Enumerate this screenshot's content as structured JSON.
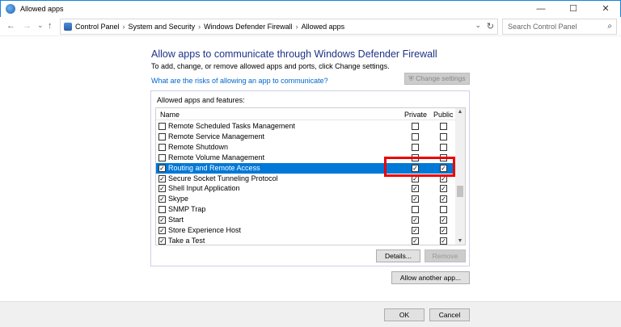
{
  "window": {
    "title": "Allowed apps",
    "minimize": "—",
    "maximize": "☐",
    "close": "✕"
  },
  "address": {
    "back": "←",
    "forward": "→",
    "recent": "⌄",
    "up": "↑",
    "crumbs": [
      "Control Panel",
      "System and Security",
      "Windows Defender Firewall",
      "Allowed apps"
    ],
    "separator": "›",
    "dropdown": "⌄",
    "refresh": "↻",
    "search_placeholder": "Search Control Panel"
  },
  "main": {
    "heading": "Allow apps to communicate through Windows Defender Firewall",
    "subtext": "To add, change, or remove allowed apps and ports, click Change settings.",
    "risk_link": "What are the risks of allowing an app to communicate?",
    "change_settings": "Change settings"
  },
  "list": {
    "label": "Allowed apps and features:",
    "columns": {
      "name": "Name",
      "private": "Private",
      "public": "Public"
    },
    "rows": [
      {
        "name": "Remote Scheduled Tasks Management",
        "enabled": false,
        "private": false,
        "public": false
      },
      {
        "name": "Remote Service Management",
        "enabled": false,
        "private": false,
        "public": false
      },
      {
        "name": "Remote Shutdown",
        "enabled": false,
        "private": false,
        "public": false
      },
      {
        "name": "Remote Volume Management",
        "enabled": false,
        "private": false,
        "public": false
      },
      {
        "name": "Routing and Remote Access",
        "enabled": true,
        "private": true,
        "public": true,
        "selected": true
      },
      {
        "name": "Secure Socket Tunneling Protocol",
        "enabled": true,
        "private": true,
        "public": true
      },
      {
        "name": "Shell Input Application",
        "enabled": true,
        "private": true,
        "public": true
      },
      {
        "name": "Skype",
        "enabled": true,
        "private": true,
        "public": true
      },
      {
        "name": "SNMP Trap",
        "enabled": false,
        "private": false,
        "public": false
      },
      {
        "name": "Start",
        "enabled": true,
        "private": true,
        "public": true
      },
      {
        "name": "Store Experience Host",
        "enabled": true,
        "private": true,
        "public": true
      },
      {
        "name": "Take a Test",
        "enabled": true,
        "private": true,
        "public": true
      }
    ],
    "details": "Details...",
    "remove": "Remove"
  },
  "allow_another": "Allow another app...",
  "footer": {
    "ok": "OK",
    "cancel": "Cancel"
  }
}
